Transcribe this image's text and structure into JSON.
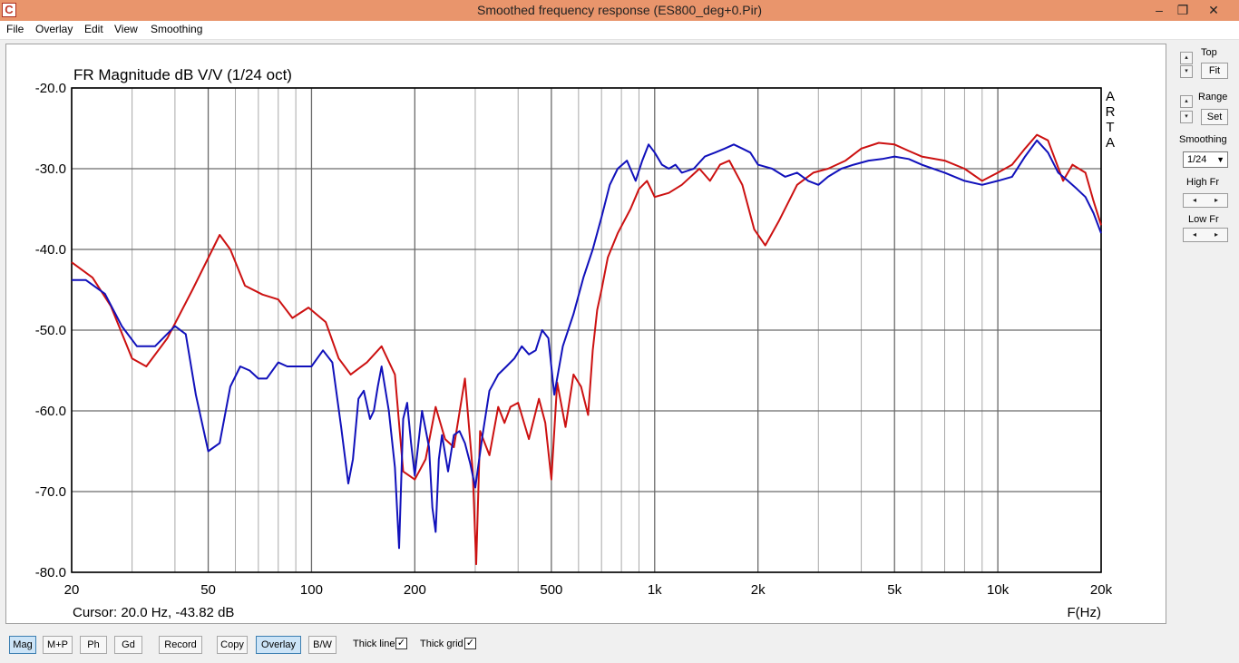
{
  "window": {
    "title": "Smoothed frequency response (ES800_deg+0.Pir)",
    "icon_letter": "C",
    "minimize": "–",
    "restore": "❐",
    "close": "✕"
  },
  "menu": [
    "File",
    "Overlay",
    "Edit",
    "View",
    "Smoothing"
  ],
  "plot": {
    "arta_mark": [
      "A",
      "R",
      "T",
      "A"
    ],
    "cursor_readout": "Cursor: 20.0 Hz, -43.82 dB"
  },
  "chart_data": {
    "type": "line",
    "title": "FR Magnitude dB V/V (1/24 oct)",
    "xlabel": "F(Hz)",
    "ylabel": "",
    "x_scale": "log",
    "xlim": [
      20,
      20000
    ],
    "ylim": [
      -80,
      -20
    ],
    "grid": true,
    "x_tick_labels": [
      {
        "value": 20,
        "label": "20"
      },
      {
        "value": 50,
        "label": "50"
      },
      {
        "value": 100,
        "label": "100"
      },
      {
        "value": 200,
        "label": "200"
      },
      {
        "value": 500,
        "label": "500"
      },
      {
        "value": 1000,
        "label": "1k"
      },
      {
        "value": 2000,
        "label": "2k"
      },
      {
        "value": 5000,
        "label": "5k"
      },
      {
        "value": 10000,
        "label": "10k"
      },
      {
        "value": 20000,
        "label": "20k"
      }
    ],
    "x_minor_grid": [
      30,
      40,
      60,
      70,
      80,
      90,
      300,
      400,
      600,
      700,
      800,
      900,
      3000,
      4000,
      6000,
      7000,
      8000,
      9000
    ],
    "y_ticks": [
      {
        "value": -20,
        "label": "-20.0"
      },
      {
        "value": -30,
        "label": "-30.0"
      },
      {
        "value": -40,
        "label": "-40.0"
      },
      {
        "value": -50,
        "label": "-50.0"
      },
      {
        "value": -60,
        "label": "-60.0"
      },
      {
        "value": -70,
        "label": "-70.0"
      },
      {
        "value": -80,
        "label": "-80.0"
      }
    ],
    "series": [
      {
        "color": "#cc1111",
        "x": [
          20,
          23,
          26,
          30,
          33,
          38,
          45,
          54,
          58,
          64,
          72,
          80,
          88,
          98,
          110,
          120,
          130,
          145,
          160,
          175,
          185,
          200,
          215,
          230,
          245,
          260,
          280,
          295,
          302,
          310,
          330,
          350,
          365,
          380,
          400,
          430,
          460,
          480,
          500,
          520,
          550,
          580,
          610,
          640,
          660,
          680,
          700,
          730,
          780,
          850,
          900,
          950,
          1000,
          1100,
          1200,
          1350,
          1450,
          1550,
          1650,
          1800,
          1950,
          2100,
          2300,
          2600,
          2900,
          3200,
          3600,
          4000,
          4500,
          5000,
          5500,
          6000,
          7000,
          8000,
          9000,
          10000,
          11000,
          12000,
          13000,
          14000,
          15500,
          16500,
          18000,
          19000,
          20000
        ],
        "y": [
          -41.6,
          -43.5,
          -47.0,
          -53.5,
          -54.5,
          -51.0,
          -45.0,
          -38.2,
          -40.0,
          -44.5,
          -45.6,
          -46.2,
          -48.5,
          -47.2,
          -49.0,
          -53.5,
          -55.5,
          -54.0,
          -52.0,
          -55.5,
          -67.5,
          -68.5,
          -66.0,
          -59.5,
          -63.5,
          -64.5,
          -56.0,
          -67.5,
          -79.0,
          -62.5,
          -65.5,
          -59.5,
          -61.5,
          -59.5,
          -59.0,
          -63.5,
          -58.5,
          -61.5,
          -68.5,
          -56.5,
          -62.0,
          -55.5,
          -57.0,
          -60.5,
          -52.5,
          -47.5,
          -45.0,
          -41.0,
          -38.0,
          -35.0,
          -32.5,
          -31.5,
          -33.5,
          -33.0,
          -32.0,
          -30.0,
          -31.5,
          -29.5,
          -29.0,
          -32.0,
          -37.5,
          -39.5,
          -36.5,
          -32.0,
          -30.5,
          -30.0,
          -29.0,
          -27.5,
          -26.8,
          -27.0,
          -27.8,
          -28.5,
          -29.0,
          -30.0,
          -31.5,
          -30.5,
          -29.5,
          -27.5,
          -25.8,
          -26.5,
          -31.5,
          -29.5,
          -30.5,
          -34.0,
          -37.0
        ]
      },
      {
        "color": "#1111bb",
        "x": [
          20,
          22,
          25,
          28,
          31,
          35,
          40,
          43,
          46,
          50,
          54,
          58,
          62,
          66,
          70,
          74,
          80,
          85,
          92,
          100,
          108,
          115,
          122,
          128,
          132,
          137,
          142,
          148,
          152,
          156,
          160,
          168,
          175,
          180,
          185,
          190,
          195,
          200,
          210,
          220,
          225,
          230,
          235,
          240,
          250,
          260,
          270,
          280,
          290,
          300,
          315,
          330,
          340,
          350,
          370,
          390,
          410,
          430,
          450,
          470,
          490,
          510,
          540,
          580,
          620,
          660,
          700,
          740,
          780,
          830,
          880,
          920,
          960,
          1000,
          1050,
          1100,
          1150,
          1200,
          1300,
          1400,
          1500,
          1600,
          1700,
          1800,
          1900,
          2000,
          2200,
          2400,
          2600,
          2800,
          3000,
          3200,
          3500,
          3800,
          4200,
          4600,
          5000,
          5500,
          6000,
          7000,
          8000,
          9000,
          10000,
          11000,
          12000,
          13000,
          14000,
          15000,
          16000,
          17000,
          18000,
          19000,
          20000
        ],
        "y": [
          -43.8,
          -43.8,
          -45.5,
          -49.5,
          -52.0,
          -52.0,
          -49.5,
          -50.5,
          -58.0,
          -65.0,
          -64.0,
          -57.0,
          -54.5,
          -55.0,
          -56.0,
          -56.0,
          -54.0,
          -54.5,
          -54.5,
          -54.5,
          -52.5,
          -54.0,
          -62.0,
          -69.0,
          -66.0,
          -58.5,
          -57.5,
          -61.0,
          -60.0,
          -57.0,
          -54.5,
          -60.0,
          -67.0,
          -77.0,
          -61.0,
          -59.0,
          -64.0,
          -68.0,
          -60.0,
          -64.5,
          -72.0,
          -75.0,
          -66.0,
          -63.0,
          -67.5,
          -63.0,
          -62.5,
          -64.0,
          -66.5,
          -69.5,
          -63.0,
          -57.5,
          -56.5,
          -55.5,
          -54.5,
          -53.5,
          -52.0,
          -53.0,
          -52.5,
          -50.0,
          -51.0,
          -58.0,
          -52.0,
          -48.0,
          -43.5,
          -40.0,
          -36.0,
          -32.0,
          -30.0,
          -29.0,
          -31.5,
          -29.0,
          -27.0,
          -28.0,
          -29.5,
          -30.0,
          -29.5,
          -30.5,
          -30.0,
          -28.5,
          -28.0,
          -27.5,
          -27.0,
          -27.5,
          -28.0,
          -29.5,
          -30.0,
          -31.0,
          -30.5,
          -31.5,
          -32.0,
          -31.0,
          -30.0,
          -29.5,
          -29.0,
          -28.8,
          -28.5,
          -28.8,
          -29.5,
          -30.5,
          -31.5,
          -32.0,
          -31.5,
          -31.0,
          -28.5,
          -26.5,
          -28.0,
          -30.5,
          -31.5,
          -32.5,
          -33.5,
          -35.5,
          -38.0
        ]
      }
    ]
  },
  "right_panel": {
    "top_label": "Top",
    "fit_label": "Fit",
    "range_label": "Range",
    "set_label": "Set",
    "smoothing_label": "Smoothing",
    "smoothing_value": "1/24",
    "high_fr_label": "High Fr",
    "low_fr_label": "Low Fr",
    "arrow_left": "◂",
    "arrow_right": "▸",
    "arrow_up": "▴",
    "arrow_down": "▾"
  },
  "bottom_bar": {
    "buttons": [
      "Mag",
      "M+P",
      "Ph",
      "Gd",
      "Record",
      "Copy",
      "Overlay",
      "B/W"
    ],
    "thick_line_label": "Thick line",
    "thick_grid_label": "Thick grid",
    "check_mark": "✓"
  },
  "colors": {
    "title_bar": "#e9956c",
    "active_button": "#cce4f7"
  }
}
